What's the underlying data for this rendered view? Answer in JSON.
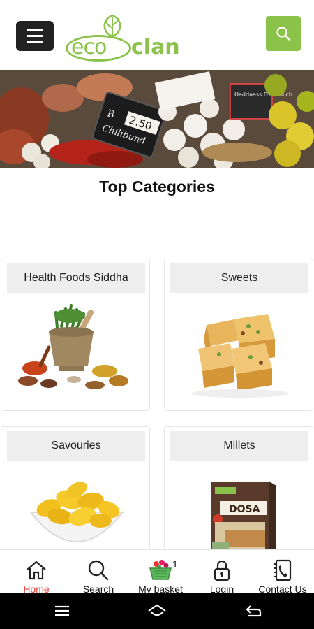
{
  "header": {
    "menu_icon": "hamburger-menu-icon",
    "logo": {
      "eco": "eco",
      "clan": "clan"
    },
    "search_icon": "search-icon",
    "brand_color": "#8bc34a"
  },
  "banner": {
    "price_tag": "2.50",
    "price_prefix": "B",
    "tag_text": "Chilibund",
    "sign_text": "Haddaass Freundlich"
  },
  "main": {
    "section_title": "Top Categories",
    "categories": [
      {
        "label": "Health Foods Siddha"
      },
      {
        "label": "Sweets"
      },
      {
        "label": "Savouries"
      },
      {
        "label": "Millets"
      }
    ],
    "product_box_text": "DOSA"
  },
  "bottom_nav": {
    "items": [
      {
        "label": "Home",
        "icon": "home-icon",
        "active": true
      },
      {
        "label": "Search",
        "icon": "search-icon"
      },
      {
        "label": "My basket",
        "icon": "basket-icon",
        "badge": "1"
      },
      {
        "label": "Login",
        "icon": "lock-icon"
      },
      {
        "label": "Contact Us",
        "icon": "phone-book-icon"
      }
    ],
    "active_color": "#e53935"
  },
  "system_bar": {
    "icons": [
      "recent-apps-icon",
      "home-system-icon",
      "back-icon"
    ]
  }
}
